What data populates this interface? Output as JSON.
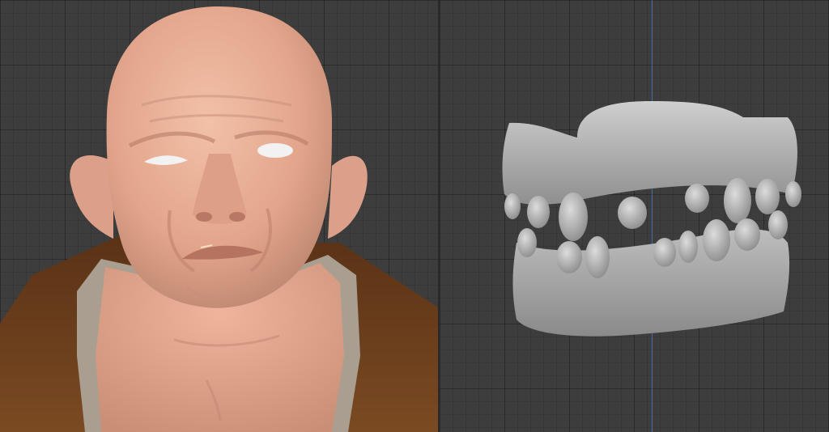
{
  "viewports": [
    {
      "id": "left",
      "content": "sculpted-head",
      "colors": {
        "background": "#3d3d3d",
        "skin": "#e7ad94",
        "skin_shadow": "#c98b74",
        "collar": "#a89c8c",
        "coat": "#6b3f1d",
        "eye": "#f2f2f2"
      }
    },
    {
      "id": "right",
      "content": "sculpted-jaw",
      "colors": {
        "background": "#3d3d3d",
        "gum": "#b4b4b4",
        "gum_shadow": "#8a8a8a",
        "tooth": "#c4c4c4",
        "axis": "#4a73b8"
      }
    }
  ]
}
